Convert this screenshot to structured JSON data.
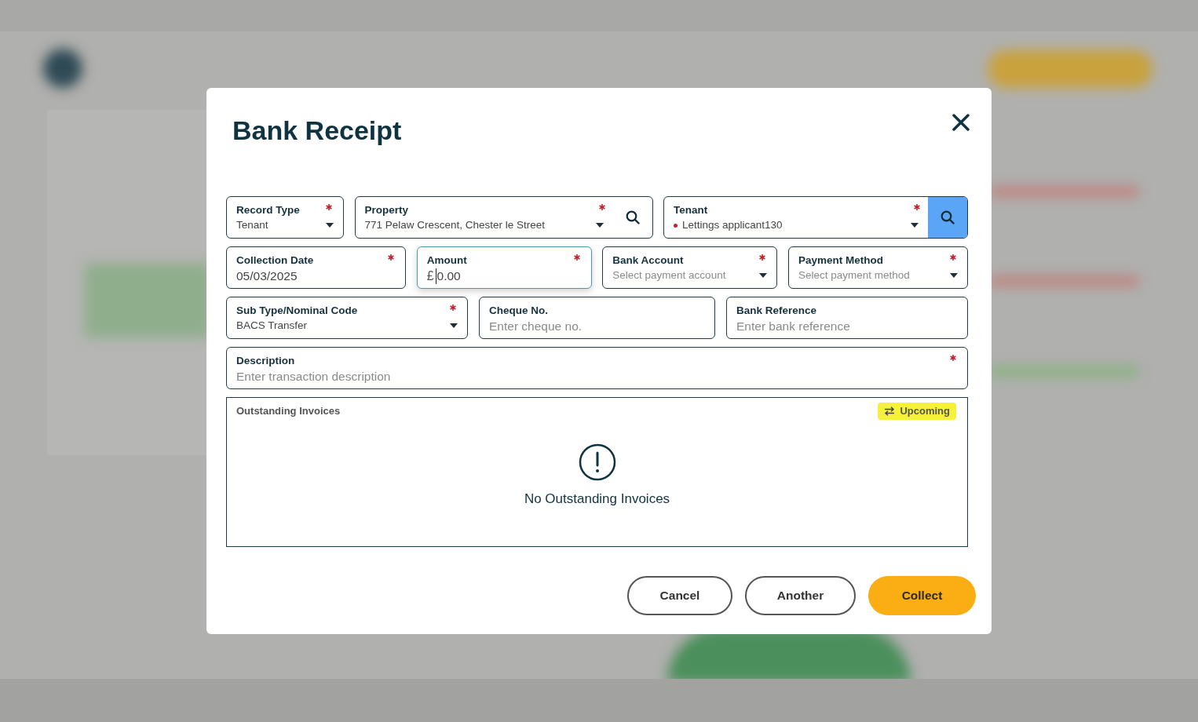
{
  "dialog": {
    "title": "Bank Receipt",
    "rows": [
      [
        {
          "kind": "select",
          "label": "Record Type",
          "value": "Tenant",
          "required": true,
          "focused": false
        },
        {
          "kind": "search-select",
          "label": "Property",
          "value": "771 Pelaw Crescent, Chester le Street",
          "required": true,
          "focused": false
        },
        {
          "kind": "button-select",
          "label": "Tenant",
          "value": "Lettings applicant130",
          "color": "#c0262d",
          "required": true,
          "focused": false
        }
      ],
      [
        {
          "kind": "text",
          "label": "Collection Date",
          "value": "05/03/2025",
          "required": true,
          "focused": false
        },
        {
          "kind": "money",
          "label": "Amount",
          "prefix": "£",
          "value": "0.00",
          "required": true,
          "focused": true
        },
        {
          "kind": "select",
          "label": "Bank Account",
          "placeholder": "Select payment account",
          "required": true,
          "focused": false
        },
        {
          "kind": "select",
          "label": "Payment Method",
          "placeholder": "Select payment method",
          "required": true,
          "focused": false
        }
      ],
      [
        {
          "kind": "select",
          "label": "Sub Type/Nominal Code",
          "value": "BACS Transfer",
          "required": true,
          "focused": false
        },
        {
          "kind": "text",
          "label": "Cheque No.",
          "placeholder": "Enter cheque no.",
          "required": false,
          "focused": false
        },
        {
          "kind": "text",
          "label": "Bank Reference",
          "placeholder": "Enter bank reference",
          "required": false,
          "focused": false
        }
      ],
      [
        {
          "kind": "text",
          "label": "Description",
          "placeholder": "Enter transaction description",
          "required": true,
          "focused": false
        }
      ]
    ],
    "invoices": {
      "title": "Outstanding Invoices",
      "toggle": "Upcoming",
      "empty_message": "No Outstanding Invoices"
    },
    "buttons": [
      {
        "kind": "outline",
        "label": "Cancel"
      },
      {
        "kind": "outline",
        "label": "Another"
      },
      {
        "kind": "primary",
        "label": "Collect"
      }
    ]
  }
}
